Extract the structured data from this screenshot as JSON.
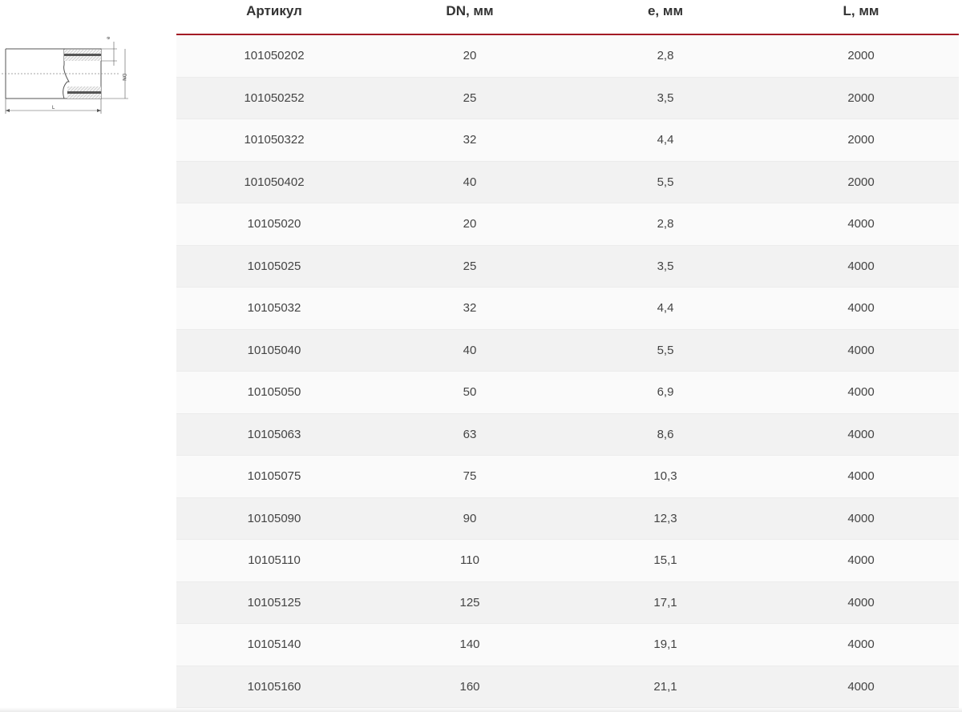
{
  "diagram": {
    "label_e": "e",
    "label_dn": "DN",
    "label_l": "L"
  },
  "table": {
    "headers": [
      "Артикул",
      "DN, мм",
      "e, мм",
      "L, мм"
    ],
    "rows": [
      [
        "101050202",
        "20",
        "2,8",
        "2000"
      ],
      [
        "101050252",
        "25",
        "3,5",
        "2000"
      ],
      [
        "101050322",
        "32",
        "4,4",
        "2000"
      ],
      [
        "101050402",
        "40",
        "5,5",
        "2000"
      ],
      [
        "10105020",
        "20",
        "2,8",
        "4000"
      ],
      [
        "10105025",
        "25",
        "3,5",
        "4000"
      ],
      [
        "10105032",
        "32",
        "4,4",
        "4000"
      ],
      [
        "10105040",
        "40",
        "5,5",
        "4000"
      ],
      [
        "10105050",
        "50",
        "6,9",
        "4000"
      ],
      [
        "10105063",
        "63",
        "8,6",
        "4000"
      ],
      [
        "10105075",
        "75",
        "10,3",
        "4000"
      ],
      [
        "10105090",
        "90",
        "12,3",
        "4000"
      ],
      [
        "10105110",
        "110",
        "15,1",
        "4000"
      ],
      [
        "10105125",
        "125",
        "17,1",
        "4000"
      ],
      [
        "10105140",
        "140",
        "19,1",
        "4000"
      ],
      [
        "10105160",
        "160",
        "21,1",
        "4000"
      ]
    ]
  },
  "colors": {
    "header_rule": "#a31a24",
    "row_odd": "#fafafa",
    "row_even": "#f2f2f2"
  }
}
